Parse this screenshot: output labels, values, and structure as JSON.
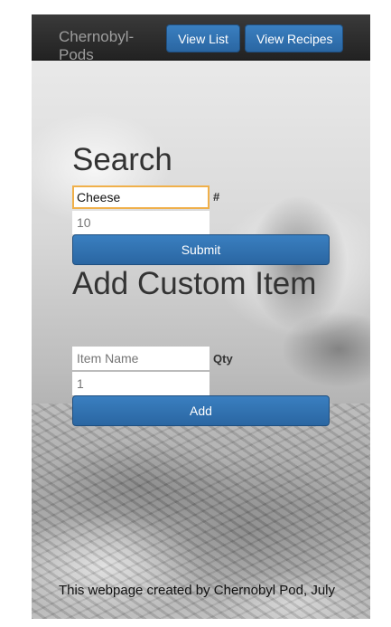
{
  "navbar": {
    "brand": "Chernobyl-Pods",
    "buttons": {
      "view_list": "View List",
      "view_recipes": "View Recipes"
    }
  },
  "search": {
    "title": "Search",
    "query_value": "Cheese",
    "hash_label": "#",
    "count_placeholder": "10",
    "submit_label": "Submit"
  },
  "custom_item": {
    "title": "Add Custom Item",
    "name_placeholder": "Item Name",
    "qty_label": "Qty",
    "qty_placeholder": "1",
    "add_label": "Add"
  },
  "footer": {
    "text": "This webpage created by Chernobyl Pod, July"
  },
  "colors": {
    "primary_button": "#2a66a2",
    "navbar": "#222222",
    "focus_border": "#f0b04a"
  }
}
